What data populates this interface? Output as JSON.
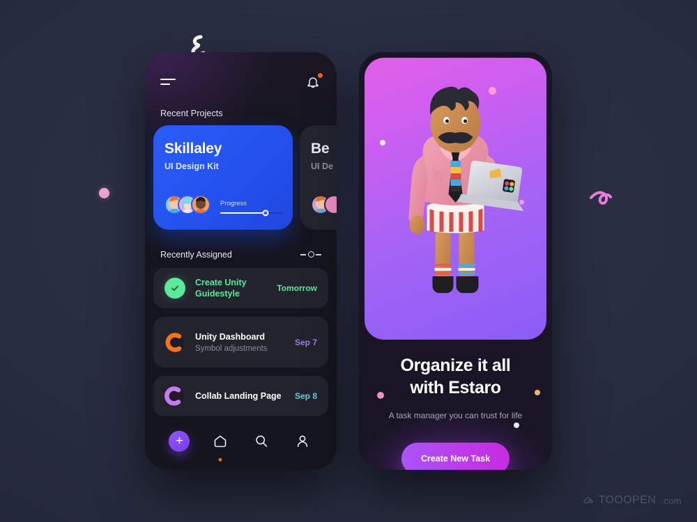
{
  "background": {
    "color": "#2a2e42"
  },
  "decorations": {
    "squiggle_top": "squiggle-icon",
    "squiggle_right": "squiggle-icon",
    "dot_left": "decorative-dot"
  },
  "left_phone": {
    "topbar": {
      "menu_icon": "hamburger-menu-icon",
      "bell_icon": "notification-bell-icon",
      "bell_badge": true
    },
    "recent_projects": {
      "title": "Recent Projects",
      "cards": [
        {
          "name": "Skillaley",
          "subtitle": "UI Design Kit",
          "progress_label": "Progress",
          "progress_value": 72,
          "accent": "#2b5cf6",
          "avatars": [
            "avatar-orange-hair",
            "avatar-blue-hair",
            "avatar-dark-skin"
          ]
        },
        {
          "name": "Be",
          "subtitle": "UI De",
          "accent": "#24242e",
          "avatars": [
            "avatar-orange-hair",
            "avatar-pink"
          ]
        }
      ]
    },
    "recently_assigned": {
      "title": "Recently Assigned",
      "filter_icon": "slider-filter-icon",
      "tasks": [
        {
          "icon": "check-circle-icon",
          "title": "Create Unity Guidestyle",
          "desc": "",
          "date": "Tomorrow",
          "color": "#5ee89b",
          "title_color": "#5ee89b",
          "date_color": "#5ee89b"
        },
        {
          "icon": "progress-ring-icon",
          "title": "Unity Dashboard",
          "desc": "Symbol adjustments",
          "date": "Sep 7",
          "color": "#f2751e",
          "title_color": "#ffffff",
          "date_color": "#9b7ce8"
        },
        {
          "icon": "progress-ring-icon",
          "title": "Collab Landing Page",
          "desc": "",
          "date": "Sep 8",
          "color": "#c77cf0",
          "title_color": "#ffffff",
          "date_color": "#6fc9d8"
        }
      ]
    },
    "navbar": {
      "items": [
        {
          "icon": "plus-icon",
          "label": "Add",
          "active": false
        },
        {
          "icon": "home-icon",
          "label": "Home",
          "active": true
        },
        {
          "icon": "search-icon",
          "label": "Search",
          "active": false
        },
        {
          "icon": "profile-icon",
          "label": "Profile",
          "active": false
        }
      ]
    }
  },
  "right_phone": {
    "hero": {
      "illustration": "3d-man-with-laptop-illustration",
      "gradient_from": "#e060e8",
      "gradient_to": "#8b5cf6"
    },
    "headline_line1": "Organize it all",
    "headline_line2": "with Estaro",
    "subtitle": "A task manager you can trust for life",
    "cta_label": "Create New Task",
    "cta_gradient_from": "#a855f7",
    "cta_gradient_to": "#c72ae0"
  },
  "watermark": {
    "icon": "cloud-home-icon",
    "name": "TOOOPEN",
    "suffix": ".com"
  }
}
